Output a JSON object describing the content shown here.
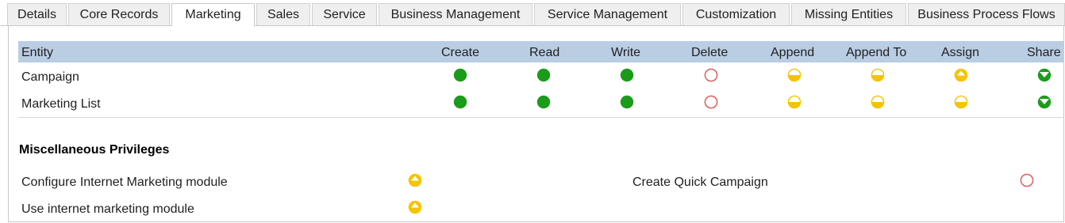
{
  "tabs": [
    {
      "label": "Details",
      "active": false
    },
    {
      "label": "Core Records",
      "active": false
    },
    {
      "label": "Marketing",
      "active": true
    },
    {
      "label": "Sales",
      "active": false
    },
    {
      "label": "Service",
      "active": false
    },
    {
      "label": "Business Management",
      "active": false
    },
    {
      "label": "Service Management",
      "active": false
    },
    {
      "label": "Customization",
      "active": false
    },
    {
      "label": "Missing Entities",
      "active": false
    },
    {
      "label": "Business Process Flows",
      "active": false
    }
  ],
  "grid": {
    "headers": [
      "Entity",
      "Create",
      "Read",
      "Write",
      "Delete",
      "Append",
      "Append To",
      "Assign",
      "Share"
    ],
    "rows": [
      {
        "entity": "Campaign",
        "levels": [
          "organization",
          "organization",
          "organization",
          "none",
          "business-unit",
          "business-unit",
          "user",
          "parent-child-business-unit"
        ]
      },
      {
        "entity": "Marketing List",
        "levels": [
          "organization",
          "organization",
          "organization",
          "none",
          "business-unit",
          "business-unit",
          "business-unit",
          "parent-child-business-unit"
        ]
      }
    ]
  },
  "misc": {
    "title": "Miscellaneous Privileges",
    "items": [
      {
        "label": "Configure Internet Marketing module",
        "level": "user"
      },
      {
        "label": "Create Quick Campaign",
        "level": "none"
      },
      {
        "label": "Use internet marketing module",
        "level": "user"
      }
    ]
  },
  "colors": {
    "header_bg": "#b9cde3",
    "organization": "#1a9c1a",
    "business_unit": "#f5c400",
    "none": "#e06666"
  }
}
